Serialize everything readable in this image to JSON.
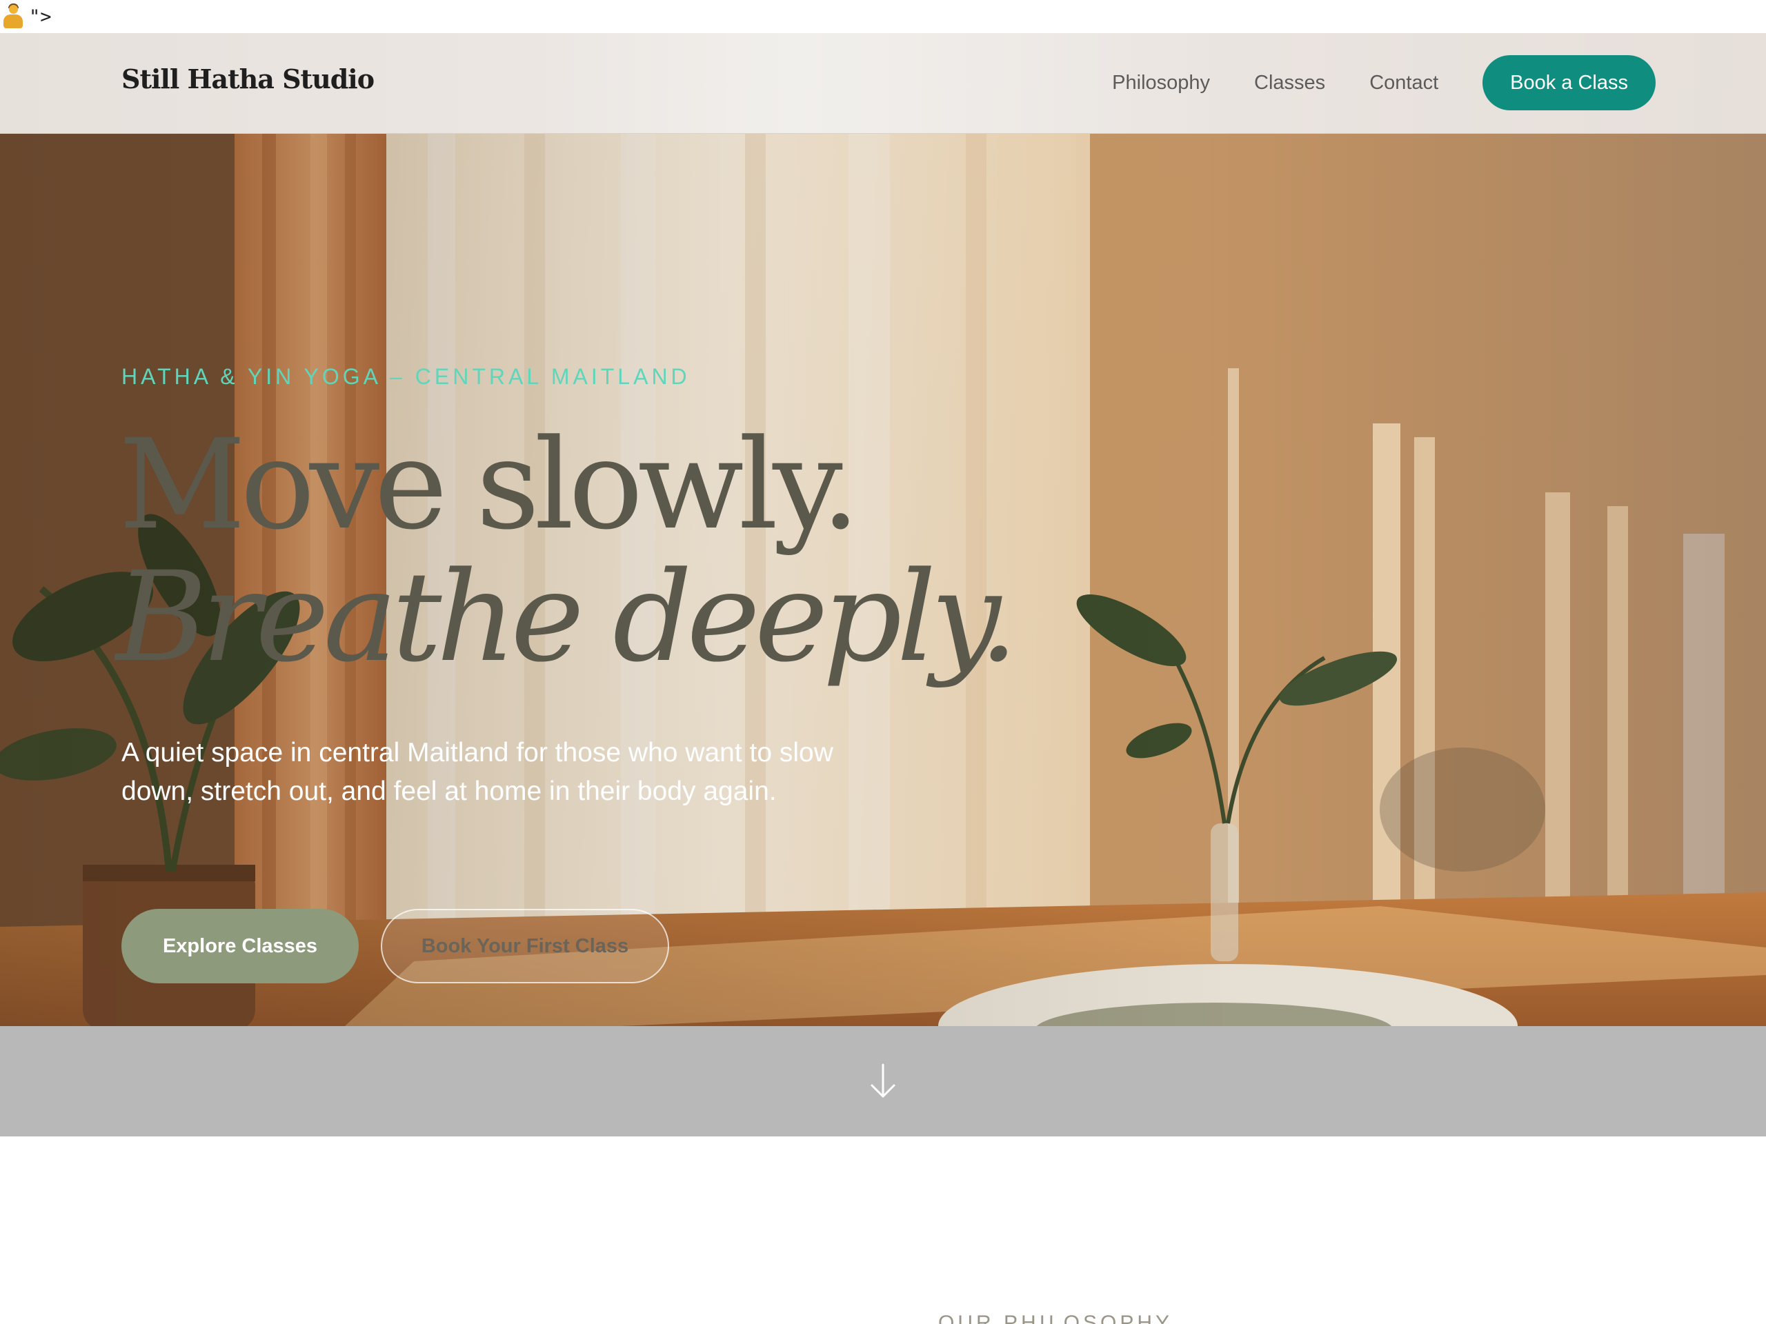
{
  "stray_text": "\">",
  "header": {
    "brand": "Still Hatha Studio",
    "nav": [
      {
        "label": "Philosophy"
      },
      {
        "label": "Classes"
      },
      {
        "label": "Contact"
      }
    ],
    "cta_label": "Book a Class",
    "cta_color": "#0f8e80"
  },
  "hero": {
    "eyebrow": "HATHA & YIN YOGA – CENTRAL MAITLAND",
    "headline_line1": "Move slowly.",
    "headline_line2": "Breathe deeply.",
    "description": "A quiet space in central Maitland for those who want to slow down, stretch out, and feel at home in their body again.",
    "primary_button": "Explore Classes",
    "secondary_button": "Book Your First Class",
    "accent_color": "#5fd6bb",
    "primary_color": "#8e9a7c"
  },
  "scroll": {
    "icon": "arrow-down-icon"
  },
  "philosophy": {
    "eyebrow": "OUR PHILOSOPHY"
  }
}
